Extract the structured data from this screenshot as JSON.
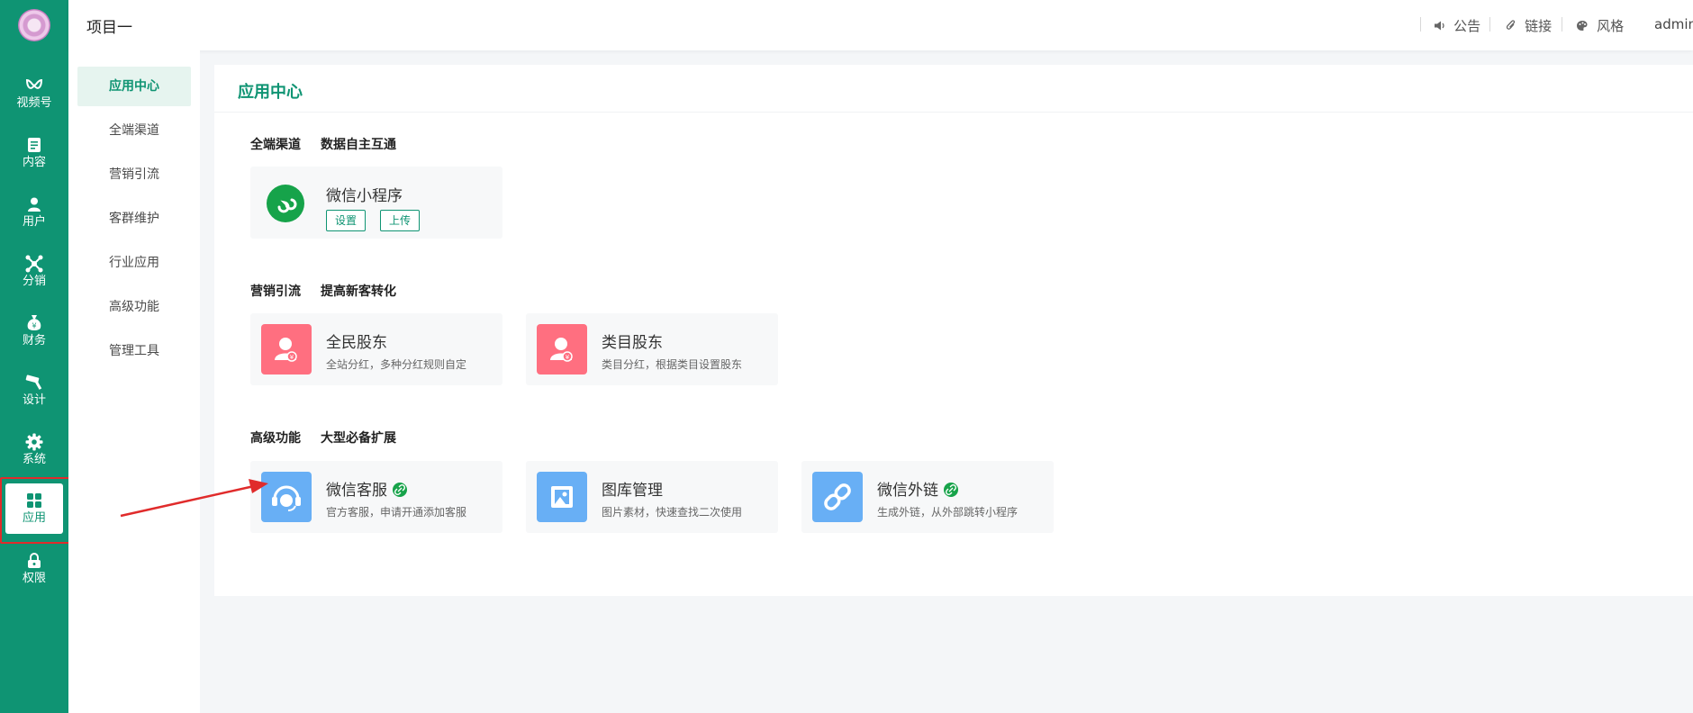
{
  "nav": {
    "items": [
      {
        "label": "视频号",
        "icon": "video-channel-icon"
      },
      {
        "label": "内容",
        "icon": "document-icon"
      },
      {
        "label": "用户",
        "icon": "user-icon"
      },
      {
        "label": "分销",
        "icon": "network-icon"
      },
      {
        "label": "财务",
        "icon": "money-bag-icon"
      },
      {
        "label": "设计",
        "icon": "brush-icon"
      },
      {
        "label": "系统",
        "icon": "gear-icon"
      },
      {
        "label": "应用",
        "icon": "grid-icon",
        "active": true
      },
      {
        "label": "权限",
        "icon": "lock-icon"
      }
    ]
  },
  "submenu": {
    "items": [
      "应用中心",
      "全端渠道",
      "营销引流",
      "客群维护",
      "行业应用",
      "高级功能",
      "管理工具"
    ],
    "active_index": 0
  },
  "header": {
    "project_title": "项目一",
    "links": [
      {
        "label": "公告",
        "icon": "speaker-icon"
      },
      {
        "label": "链接",
        "icon": "paperclip-icon"
      },
      {
        "label": "风格",
        "icon": "palette-icon"
      }
    ],
    "user": "admin"
  },
  "panel": {
    "title": "应用中心",
    "sections": [
      {
        "title": "全端渠道",
        "subtitle": "数据自主互通",
        "cards": [
          {
            "name": "微信小程序",
            "icon": "mini-program-icon",
            "buttons": [
              "设置",
              "上传"
            ]
          }
        ]
      },
      {
        "title": "营销引流",
        "subtitle": "提高新客转化",
        "cards": [
          {
            "name": "全民股东",
            "desc": "全站分红，多种分红规则自定",
            "icon": "shareholder-icon"
          },
          {
            "name": "类目股东",
            "desc": "类目分红，根据类目设置股东",
            "icon": "shareholder-icon"
          }
        ]
      },
      {
        "title": "高级功能",
        "subtitle": "大型必备扩展",
        "cards": [
          {
            "name": "微信客服",
            "desc": "官方客服，申请开通添加客服",
            "icon": "headset-icon",
            "badge": "link-icon"
          },
          {
            "name": "图库管理",
            "desc": "图片素材，快速查找二次使用",
            "icon": "gallery-icon"
          },
          {
            "name": "微信外链",
            "desc": "生成外链，从外部跳转小程序",
            "icon": "chain-icon",
            "badge": "link-icon"
          }
        ]
      }
    ]
  },
  "colors": {
    "brand_green": "#0f9473",
    "highlight_red": "#e02b2b",
    "card_red": "#ff6f80",
    "card_blue": "#68aff5"
  }
}
